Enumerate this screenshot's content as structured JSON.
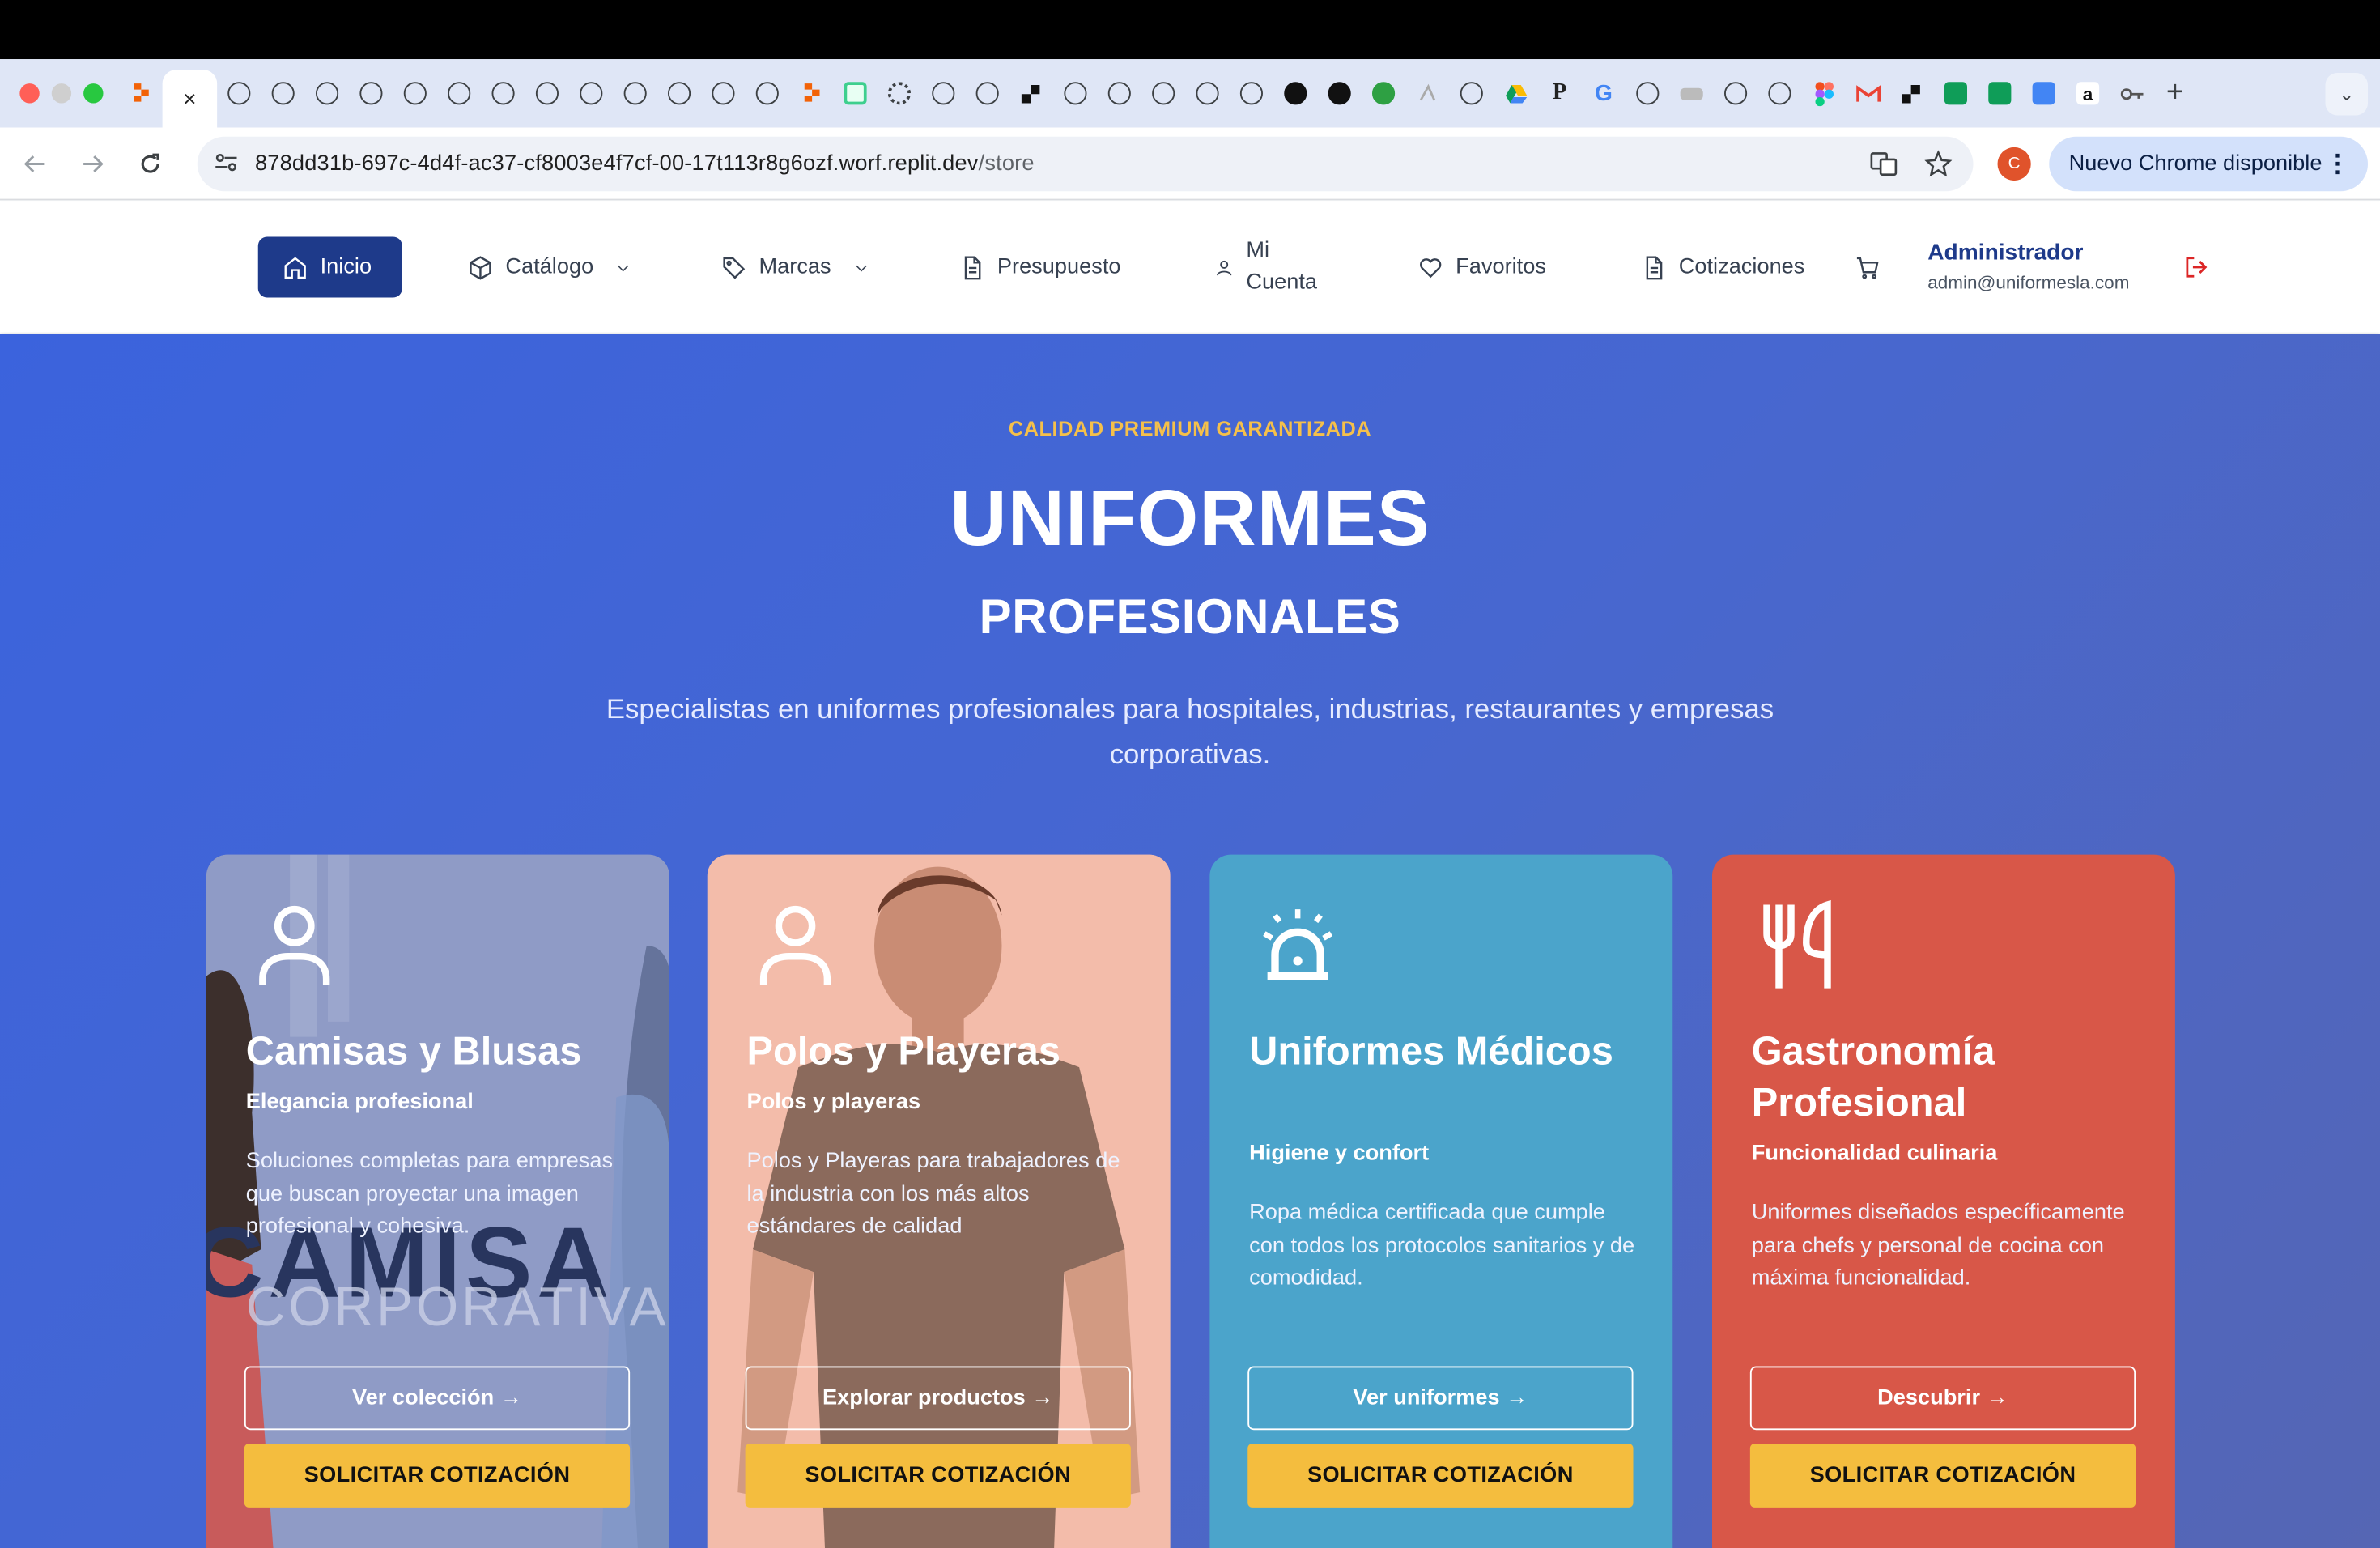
{
  "browser": {
    "active_tab_close": "×",
    "new_tab": "+",
    "url_host": "878dd31b-697c-4d4f-ac37-cf8003e4f7cf-00-17t113r8g6ozf.worf.replit.dev",
    "url_path": "/store",
    "profile_initial": "C",
    "update_label": "Nuevo Chrome disponible",
    "tab_letters": {
      "p": "P",
      "g": "G",
      "a": "a"
    }
  },
  "nav": {
    "home": "Inicio",
    "catalog": "Catálogo",
    "brands": "Marcas",
    "budget": "Presupuesto",
    "account_line1": "Mi",
    "account_line2": "Cuenta",
    "favorites": "Favoritos",
    "quotes": "Cotizaciones",
    "user_name": "Administrador",
    "user_email": "admin@uniformesla.com"
  },
  "hero": {
    "eyebrow": "CALIDAD PREMIUM GARANTIZADA",
    "title": "UNIFORMES",
    "subtitle": "PROFESIONALES",
    "lead": "Especialistas en uniformes profesionales para hospitales, industrias, restaurantes y empresas corporativas."
  },
  "cards": [
    {
      "title": "Camisas y Blusas",
      "tagline": "Elegancia profesional",
      "description": "Soluciones completas para empresas que buscan proyectar una imagen profesional y cohesiva.",
      "cta": "Ver colección →",
      "quote": "SOLICITAR COTIZACIÓN",
      "bg_text_1": "CAMISA",
      "bg_text_2": "CORPORATIVA",
      "color": "#8e9ac4"
    },
    {
      "title": "Polos y Playeras",
      "tagline": "Polos y playeras",
      "description": "Polos y Playeras para trabajadores de la industria con los más altos estándares de calidad",
      "cta": "Explorar productos →",
      "quote": "SOLICITAR COTIZACIÓN",
      "color": "#f2b9a6"
    },
    {
      "title": "Uniformes Médicos",
      "tagline": "Higiene y confort",
      "description": "Ropa médica certificada que cumple con todos los protocolos sanitarios y de comodidad.",
      "cta": "Ver uniformes →",
      "quote": "SOLICITAR COTIZACIÓN",
      "color": "#4ba4cb"
    },
    {
      "title": "Gastronomía Profesional",
      "tagline": "Funcionalidad culinaria",
      "description": "Uniformes diseñados específicamente para chefs y personal de cocina con máxima funcionalidad.",
      "cta": "Descubrir →",
      "quote": "SOLICITAR COTIZACIÓN",
      "color": "#d85748"
    }
  ],
  "colors": {
    "brand_navy": "#1e3a8a",
    "accent_yellow": "#f4bd3e",
    "hero_blue": "#3b63dd"
  }
}
